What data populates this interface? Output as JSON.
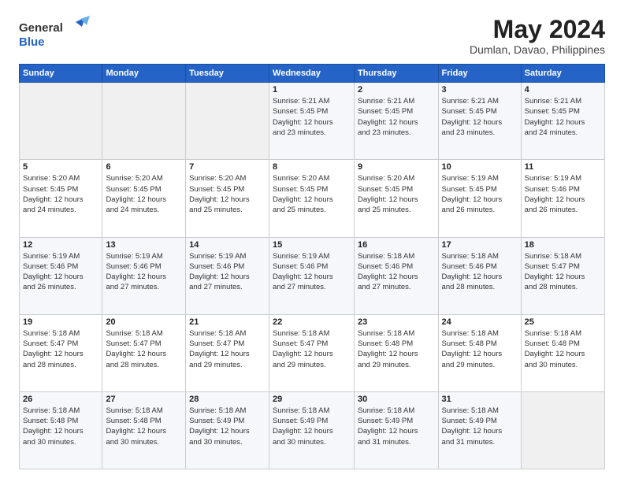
{
  "header": {
    "logo_general": "General",
    "logo_blue": "Blue",
    "month_title": "May 2024",
    "location": "Dumlan, Davao, Philippines"
  },
  "weekdays": [
    "Sunday",
    "Monday",
    "Tuesday",
    "Wednesday",
    "Thursday",
    "Friday",
    "Saturday"
  ],
  "weeks": [
    [
      {
        "day": "",
        "info": ""
      },
      {
        "day": "",
        "info": ""
      },
      {
        "day": "",
        "info": ""
      },
      {
        "day": "1",
        "info": "Sunrise: 5:21 AM\nSunset: 5:45 PM\nDaylight: 12 hours\nand 23 minutes."
      },
      {
        "day": "2",
        "info": "Sunrise: 5:21 AM\nSunset: 5:45 PM\nDaylight: 12 hours\nand 23 minutes."
      },
      {
        "day": "3",
        "info": "Sunrise: 5:21 AM\nSunset: 5:45 PM\nDaylight: 12 hours\nand 23 minutes."
      },
      {
        "day": "4",
        "info": "Sunrise: 5:21 AM\nSunset: 5:45 PM\nDaylight: 12 hours\nand 24 minutes."
      }
    ],
    [
      {
        "day": "5",
        "info": "Sunrise: 5:20 AM\nSunset: 5:45 PM\nDaylight: 12 hours\nand 24 minutes."
      },
      {
        "day": "6",
        "info": "Sunrise: 5:20 AM\nSunset: 5:45 PM\nDaylight: 12 hours\nand 24 minutes."
      },
      {
        "day": "7",
        "info": "Sunrise: 5:20 AM\nSunset: 5:45 PM\nDaylight: 12 hours\nand 25 minutes."
      },
      {
        "day": "8",
        "info": "Sunrise: 5:20 AM\nSunset: 5:45 PM\nDaylight: 12 hours\nand 25 minutes."
      },
      {
        "day": "9",
        "info": "Sunrise: 5:20 AM\nSunset: 5:45 PM\nDaylight: 12 hours\nand 25 minutes."
      },
      {
        "day": "10",
        "info": "Sunrise: 5:19 AM\nSunset: 5:45 PM\nDaylight: 12 hours\nand 26 minutes."
      },
      {
        "day": "11",
        "info": "Sunrise: 5:19 AM\nSunset: 5:46 PM\nDaylight: 12 hours\nand 26 minutes."
      }
    ],
    [
      {
        "day": "12",
        "info": "Sunrise: 5:19 AM\nSunset: 5:46 PM\nDaylight: 12 hours\nand 26 minutes."
      },
      {
        "day": "13",
        "info": "Sunrise: 5:19 AM\nSunset: 5:46 PM\nDaylight: 12 hours\nand 27 minutes."
      },
      {
        "day": "14",
        "info": "Sunrise: 5:19 AM\nSunset: 5:46 PM\nDaylight: 12 hours\nand 27 minutes."
      },
      {
        "day": "15",
        "info": "Sunrise: 5:19 AM\nSunset: 5:46 PM\nDaylight: 12 hours\nand 27 minutes."
      },
      {
        "day": "16",
        "info": "Sunrise: 5:18 AM\nSunset: 5:46 PM\nDaylight: 12 hours\nand 27 minutes."
      },
      {
        "day": "17",
        "info": "Sunrise: 5:18 AM\nSunset: 5:46 PM\nDaylight: 12 hours\nand 28 minutes."
      },
      {
        "day": "18",
        "info": "Sunrise: 5:18 AM\nSunset: 5:47 PM\nDaylight: 12 hours\nand 28 minutes."
      }
    ],
    [
      {
        "day": "19",
        "info": "Sunrise: 5:18 AM\nSunset: 5:47 PM\nDaylight: 12 hours\nand 28 minutes."
      },
      {
        "day": "20",
        "info": "Sunrise: 5:18 AM\nSunset: 5:47 PM\nDaylight: 12 hours\nand 28 minutes."
      },
      {
        "day": "21",
        "info": "Sunrise: 5:18 AM\nSunset: 5:47 PM\nDaylight: 12 hours\nand 29 minutes."
      },
      {
        "day": "22",
        "info": "Sunrise: 5:18 AM\nSunset: 5:47 PM\nDaylight: 12 hours\nand 29 minutes."
      },
      {
        "day": "23",
        "info": "Sunrise: 5:18 AM\nSunset: 5:48 PM\nDaylight: 12 hours\nand 29 minutes."
      },
      {
        "day": "24",
        "info": "Sunrise: 5:18 AM\nSunset: 5:48 PM\nDaylight: 12 hours\nand 29 minutes."
      },
      {
        "day": "25",
        "info": "Sunrise: 5:18 AM\nSunset: 5:48 PM\nDaylight: 12 hours\nand 30 minutes."
      }
    ],
    [
      {
        "day": "26",
        "info": "Sunrise: 5:18 AM\nSunset: 5:48 PM\nDaylight: 12 hours\nand 30 minutes."
      },
      {
        "day": "27",
        "info": "Sunrise: 5:18 AM\nSunset: 5:48 PM\nDaylight: 12 hours\nand 30 minutes."
      },
      {
        "day": "28",
        "info": "Sunrise: 5:18 AM\nSunset: 5:49 PM\nDaylight: 12 hours\nand 30 minutes."
      },
      {
        "day": "29",
        "info": "Sunrise: 5:18 AM\nSunset: 5:49 PM\nDaylight: 12 hours\nand 30 minutes."
      },
      {
        "day": "30",
        "info": "Sunrise: 5:18 AM\nSunset: 5:49 PM\nDaylight: 12 hours\nand 31 minutes."
      },
      {
        "day": "31",
        "info": "Sunrise: 5:18 AM\nSunset: 5:49 PM\nDaylight: 12 hours\nand 31 minutes."
      },
      {
        "day": "",
        "info": ""
      }
    ]
  ]
}
